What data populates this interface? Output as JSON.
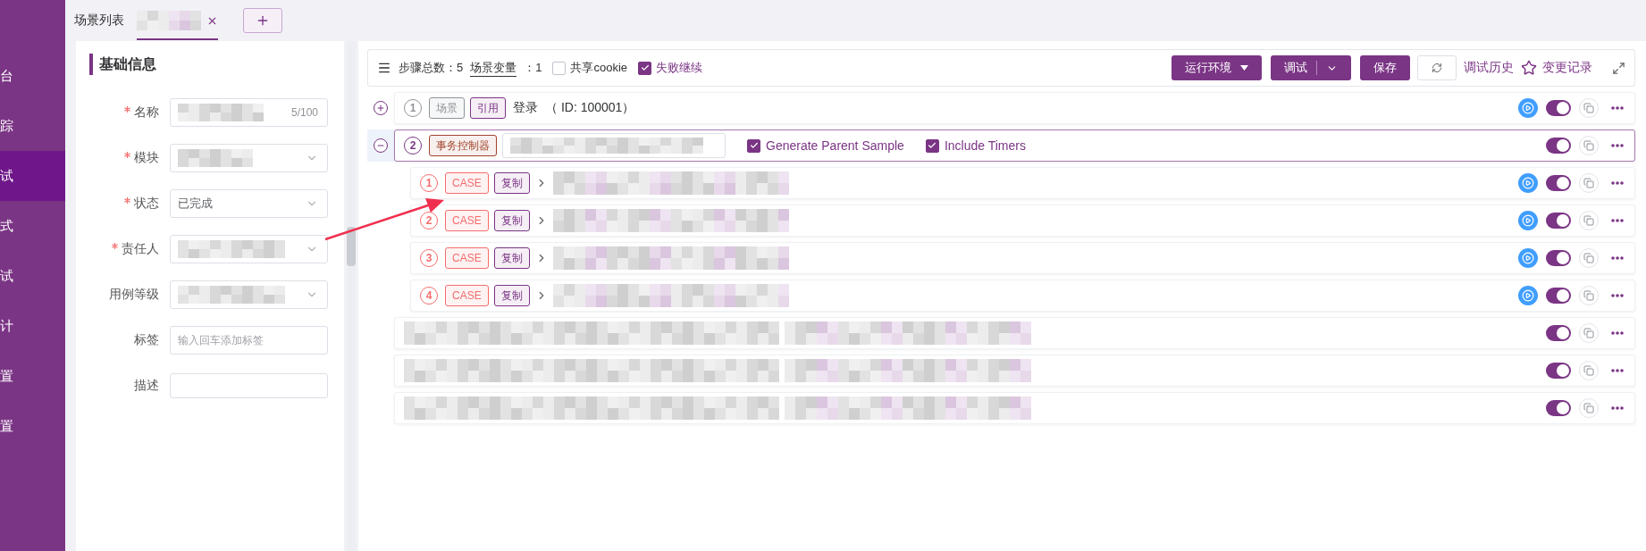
{
  "sidebar": {
    "items": [
      {
        "label": "台",
        "selected": false
      },
      {
        "label": "踪",
        "selected": false
      },
      {
        "label": "试",
        "selected": true
      },
      {
        "label": "式",
        "selected": false
      },
      {
        "label": "试",
        "selected": false
      },
      {
        "label": "计",
        "selected": false
      },
      {
        "label": "置",
        "selected": false
      },
      {
        "label": "置",
        "selected": false
      }
    ]
  },
  "tabs": {
    "items": [
      {
        "kind": "text",
        "label": "场景列表",
        "selected": false
      },
      {
        "kind": "blurred",
        "selected": true,
        "closable": true
      }
    ]
  },
  "form": {
    "title": "基础信息",
    "fields": [
      {
        "label": "名称",
        "required": true,
        "kind": "input",
        "blurred": true,
        "counter": "5/100"
      },
      {
        "label": "模块",
        "required": true,
        "kind": "select",
        "blurred": true
      },
      {
        "label": "状态",
        "required": true,
        "kind": "select",
        "value": "已完成"
      },
      {
        "label": "责任人",
        "required": true,
        "kind": "select",
        "blurred": true
      },
      {
        "label": "用例等级",
        "required": false,
        "kind": "select",
        "blurred": true
      },
      {
        "label": "标签",
        "required": false,
        "kind": "input",
        "placeholder": "输入回车添加标签"
      },
      {
        "label": "描述",
        "required": false,
        "kind": "textarea"
      }
    ]
  },
  "toolbar": {
    "step_total_label": "步骤总数：",
    "step_total": "5",
    "variables_label": "场景变量",
    "variables_count": "：1",
    "options": [
      {
        "label": "共享cookie",
        "checked": false
      },
      {
        "label": "失败继续",
        "checked": true
      }
    ],
    "buttons": [
      {
        "label": "运行环境",
        "kind": "dropdown"
      },
      {
        "label": "调试",
        "kind": "split"
      },
      {
        "label": "保存",
        "kind": "plain"
      }
    ],
    "links": [
      {
        "label": "调试历史",
        "kind": "plain"
      },
      {
        "label": "变更记录",
        "kind": "star"
      }
    ]
  },
  "steps": [
    {
      "kind": "scenario",
      "index": "1",
      "tags": [
        {
          "label": "场景",
          "color": "#909399"
        },
        {
          "label": "引用",
          "color": "#7b3585"
        }
      ],
      "title": "登录",
      "id_text": "（ ID: 100001）",
      "expanded": false,
      "runnable": true,
      "on": true
    },
    {
      "kind": "controller",
      "index": "2",
      "tags": [
        {
          "label": "事务控制器",
          "color": "#a0432c"
        }
      ],
      "name_blurred": true,
      "options": [
        {
          "label": "Generate Parent Sample",
          "checked": true
        },
        {
          "label": "Include Timers",
          "checked": true
        }
      ],
      "expanded": true,
      "runnable": false,
      "on": true,
      "children": [
        {
          "kind": "case",
          "index": "1",
          "tags": [
            {
              "label": "CASE",
              "color": "#f56c6c"
            },
            {
              "label": "复制",
              "color": "#7b3585"
            }
          ],
          "runnable": true,
          "on": true
        },
        {
          "kind": "case",
          "index": "2",
          "tags": [
            {
              "label": "CASE",
              "color": "#f56c6c"
            },
            {
              "label": "复制",
              "color": "#7b3585"
            }
          ],
          "runnable": true,
          "on": true
        },
        {
          "kind": "case",
          "index": "3",
          "tags": [
            {
              "label": "CASE",
              "color": "#f56c6c"
            },
            {
              "label": "复制",
              "color": "#7b3585"
            }
          ],
          "runnable": true,
          "on": true
        },
        {
          "kind": "case",
          "index": "4",
          "tags": [
            {
              "label": "CASE",
              "color": "#f56c6c"
            },
            {
              "label": "复制",
              "color": "#7b3585"
            }
          ],
          "runnable": true,
          "on": true
        }
      ]
    },
    {
      "kind": "blurred",
      "runnable": false,
      "on": true
    },
    {
      "kind": "blurred",
      "runnable": false,
      "on": true
    },
    {
      "kind": "blurred",
      "runnable": false,
      "on": true
    }
  ],
  "annotations": [
    {
      "kind": "arrow"
    }
  ]
}
